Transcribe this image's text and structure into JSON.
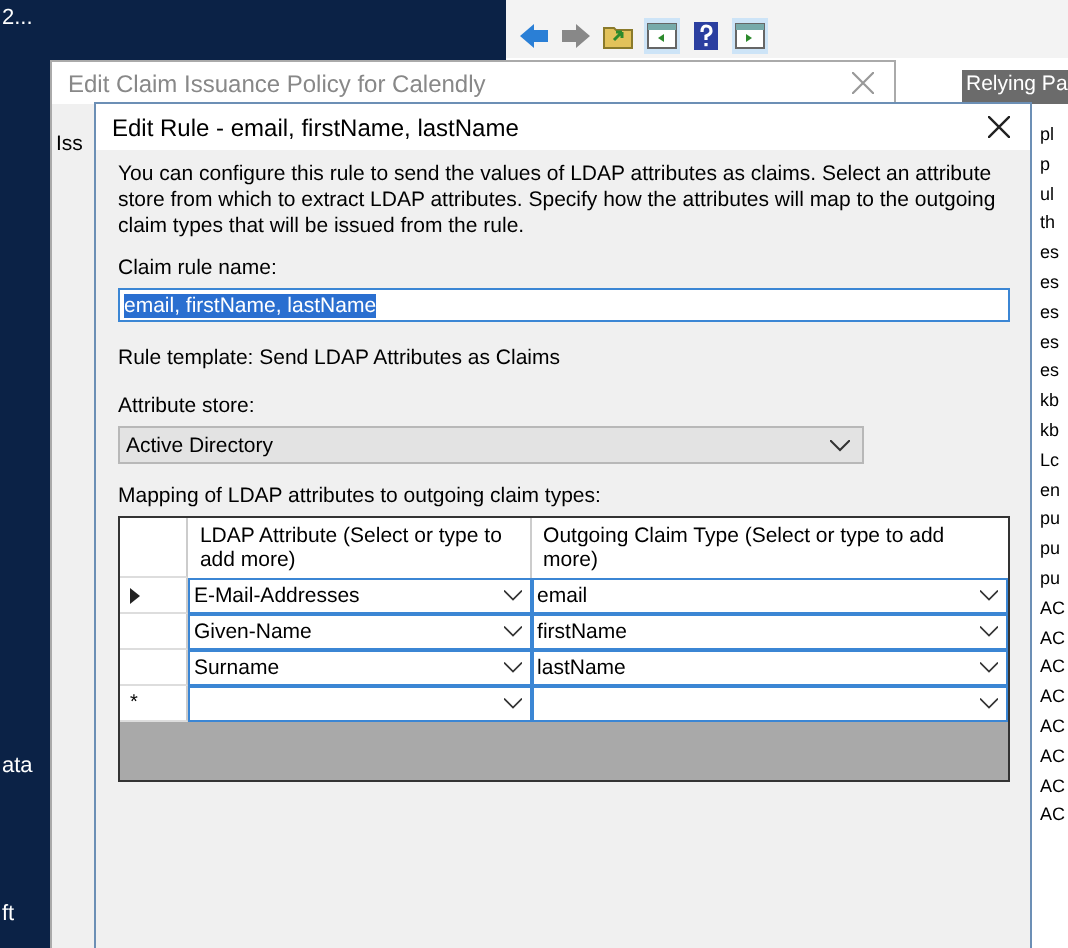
{
  "desktop": {
    "labels": [
      "2...",
      "ata",
      "ft"
    ]
  },
  "console": {
    "panel_header": "Relying Pa",
    "list_fragments": [
      "pl",
      "p",
      "ul",
      "th",
      "es",
      "es",
      "es",
      "es",
      "es",
      "kb",
      "kb",
      "Lc",
      "en",
      "pu",
      "pu",
      "pu",
      "AC",
      "AC",
      "AC",
      "AC",
      "AC",
      "AC",
      "AC",
      "AC"
    ]
  },
  "back_dialog": {
    "title": "Edit Claim Issuance Policy for Calendly",
    "tab": "Iss"
  },
  "dialog": {
    "title": "Edit Rule - email, firstName, lastName",
    "description": "You can configure this rule to send the values of LDAP attributes as claims. Select an attribute store from which to extract LDAP attributes. Specify how the attributes will map to the outgoing claim types that will be issued from the rule.",
    "claim_rule_name_label": "Claim rule name:",
    "claim_rule_name": {
      "value": "email, firstName, lastName",
      "selected": true
    },
    "rule_template": "Rule template: Send LDAP Attributes as Claims",
    "attribute_store_label": "Attribute store:",
    "attribute_store": "Active Directory",
    "mapping_label": "Mapping of LDAP attributes to outgoing claim types:",
    "columns": [
      "LDAP Attribute (Select or type to add more)",
      "Outgoing Claim Type (Select or type to add more)"
    ],
    "rows": [
      {
        "kind": "current",
        "ldap_attribute": "E-Mail-Addresses",
        "claim_type": "email"
      },
      {
        "kind": "plain",
        "ldap_attribute": "Given-Name",
        "claim_type": "firstName"
      },
      {
        "kind": "plain",
        "ldap_attribute": "Surname",
        "claim_type": "lastName"
      },
      {
        "kind": "new",
        "marker": "*"
      }
    ]
  }
}
